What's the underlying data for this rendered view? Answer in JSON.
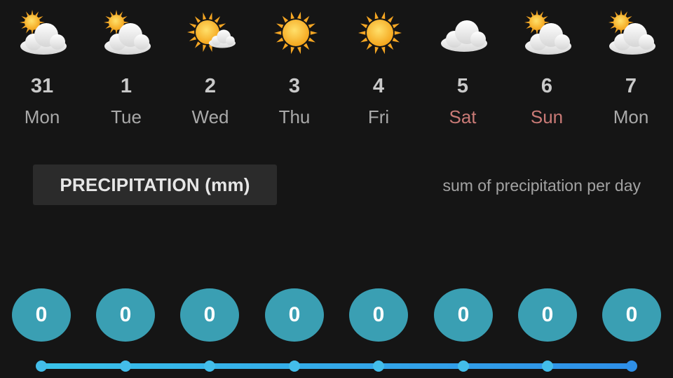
{
  "forecast": [
    {
      "num": "31",
      "name": "Mon",
      "weekend": false,
      "icon": "sun-behind-cloud-icon"
    },
    {
      "num": "1",
      "name": "Tue",
      "weekend": false,
      "icon": "sun-behind-cloud-icon"
    },
    {
      "num": "2",
      "name": "Wed",
      "weekend": false,
      "icon": "sun-with-small-cloud-icon"
    },
    {
      "num": "3",
      "name": "Thu",
      "weekend": false,
      "icon": "sun-icon"
    },
    {
      "num": "4",
      "name": "Fri",
      "weekend": false,
      "icon": "sun-icon"
    },
    {
      "num": "5",
      "name": "Sat",
      "weekend": true,
      "icon": "cloud-icon"
    },
    {
      "num": "6",
      "name": "Sun",
      "weekend": true,
      "icon": "sun-behind-cloud-icon"
    },
    {
      "num": "7",
      "name": "Mon",
      "weekend": false,
      "icon": "sun-behind-cloud-icon"
    }
  ],
  "precipitation": {
    "title": "PRECIPITATION (mm)",
    "note": "sum of precipitation per day",
    "values": [
      "0",
      "0",
      "0",
      "0",
      "0",
      "0",
      "0",
      "0"
    ]
  },
  "colors": {
    "background": "#151515",
    "weekend": "#c97a76",
    "bubble": "#3a9fb3",
    "track_start": "#39c3ea",
    "track_end": "#2e8fe8"
  }
}
